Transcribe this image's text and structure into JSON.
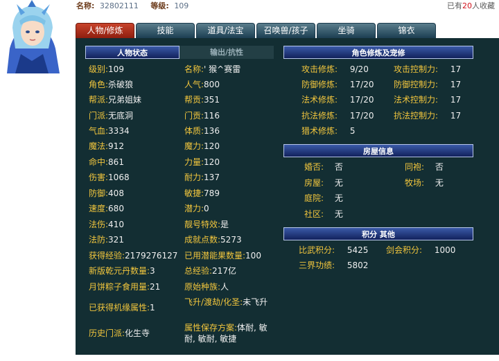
{
  "top": {
    "name_label": "名称:",
    "name_value": "32802111",
    "level_label": "等级:",
    "level_value": "109",
    "fav_prefix": "已有",
    "fav_count": "20",
    "fav_suffix": "人收藏"
  },
  "tabs": [
    "人物/修炼",
    "技能",
    "道具/法宝",
    "召唤兽/孩子",
    "坐骑",
    "锦衣"
  ],
  "left_headers": [
    "人物状态",
    "输出/抗性"
  ],
  "left_col1": [
    {
      "k": "级别:",
      "v": "109"
    },
    {
      "k": "角色:",
      "v": "杀破狼"
    },
    {
      "k": "帮派:",
      "v": "兄弟姐妹"
    },
    {
      "k": "门派:",
      "v": "无底洞"
    },
    {
      "k": "气血:",
      "v": "3334"
    },
    {
      "k": "魔法:",
      "v": "912"
    },
    {
      "k": "命中:",
      "v": "861"
    },
    {
      "k": "伤害:",
      "v": "1068"
    },
    {
      "k": "防御:",
      "v": "408"
    },
    {
      "k": "速度:",
      "v": "680"
    },
    {
      "k": "法伤:",
      "v": "410"
    },
    {
      "k": "法防:",
      "v": "321"
    },
    {
      "k": "获得经验:",
      "v": "2179276127"
    },
    {
      "k": "新版乾元丹数量:",
      "v": "3"
    },
    {
      "k": "月饼粽子食用量:",
      "v": "21"
    },
    {
      "k": "已获得机缘属性:",
      "v": "1"
    },
    {
      "k": "历史门派:",
      "v": "化生寺"
    }
  ],
  "left_col2": [
    {
      "k": "名称:",
      "v": "' 猴^赛雷"
    },
    {
      "k": "人气:",
      "v": "800"
    },
    {
      "k": "帮贡:",
      "v": "351"
    },
    {
      "k": "门贡:",
      "v": "116"
    },
    {
      "k": "体质:",
      "v": "136"
    },
    {
      "k": "魔力:",
      "v": "120"
    },
    {
      "k": "力量:",
      "v": "120"
    },
    {
      "k": "耐力:",
      "v": "137"
    },
    {
      "k": "敏捷:",
      "v": "789"
    },
    {
      "k": "潜力:",
      "v": "0"
    },
    {
      "k": "靓号特效:",
      "v": "是"
    },
    {
      "k": "成就点数:",
      "v": "5273"
    },
    {
      "k": "已用潜能果数量:",
      "v": "100"
    },
    {
      "k": "总经验:",
      "v": "217亿"
    },
    {
      "k": "原始种族:",
      "v": "人"
    },
    {
      "k": "飞升/渡劫/化圣:",
      "v": "未飞升"
    },
    {
      "k": "属性保存方案:",
      "v": "体耐, 敏耐, 敏耐, 敏捷"
    }
  ],
  "right_headers": {
    "cultivation": "角色修炼及宠修",
    "house": "房屋信息",
    "points": "积分 其他"
  },
  "cultivation_a": [
    {
      "k": "攻击修炼:",
      "v": "9/20"
    },
    {
      "k": "防御修炼:",
      "v": "17/20"
    },
    {
      "k": "法术修炼:",
      "v": "17/20"
    },
    {
      "k": "抗法修炼:",
      "v": "17/20"
    },
    {
      "k": "猎术修炼:",
      "v": "5"
    }
  ],
  "cultivation_b": [
    {
      "k": "攻击控制力:",
      "v": "17"
    },
    {
      "k": "防御控制力:",
      "v": "17"
    },
    {
      "k": "法术控制力:",
      "v": "17"
    },
    {
      "k": "抗法控制力:",
      "v": "17"
    }
  ],
  "house_a": [
    {
      "k": "婚否:",
      "v": "否"
    },
    {
      "k": "房屋:",
      "v": "无"
    },
    {
      "k": "庭院:",
      "v": "无"
    },
    {
      "k": "社区:",
      "v": "无"
    }
  ],
  "house_b": [
    {
      "k": "同袍:",
      "v": "否"
    },
    {
      "k": "牧场:",
      "v": "无"
    }
  ],
  "points": [
    {
      "k": "比武积分:",
      "v": "5425"
    },
    {
      "k": "剑会积分:",
      "v": "1000"
    },
    {
      "k": "三界功绩:",
      "v": "5802"
    }
  ]
}
